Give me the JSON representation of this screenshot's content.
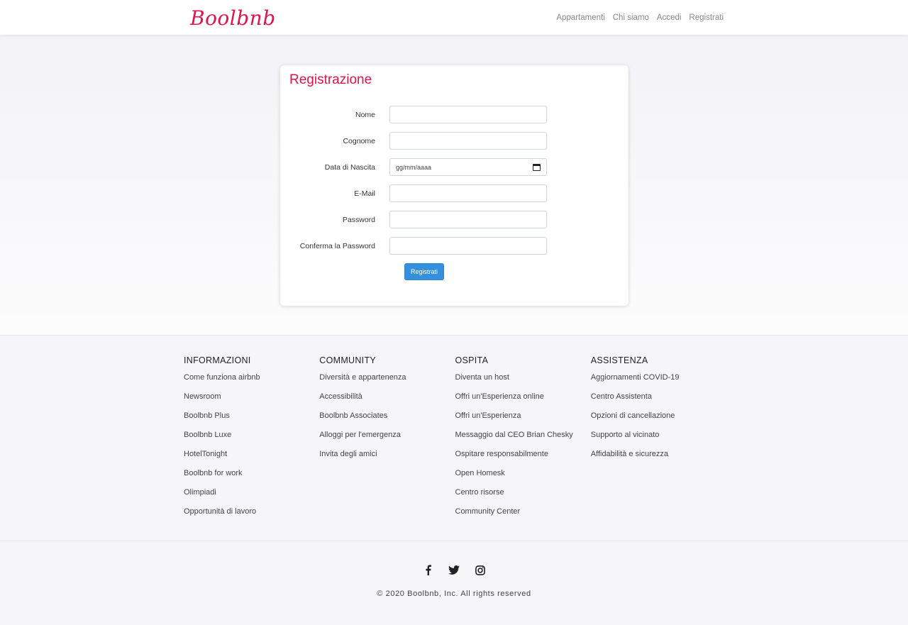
{
  "nav": {
    "brand": "Boolbnb",
    "links": [
      "Appartamenti",
      "Chi siamo",
      "Accedi",
      "Registrati"
    ]
  },
  "form": {
    "title": "Registrazione",
    "fields": [
      {
        "label": "Nome",
        "value": ""
      },
      {
        "label": "Cognome",
        "value": ""
      },
      {
        "label": "Data di Nascita",
        "value": "gg/mm/aaaa"
      },
      {
        "label": "E-Mail",
        "value": ""
      },
      {
        "label": "Password",
        "value": ""
      },
      {
        "label": "Conferma la Password",
        "value": ""
      }
    ],
    "submit_label": "Registrati",
    "accent_color": "#e0144c",
    "button_color": "#3490dc"
  },
  "footer": {
    "columns": [
      {
        "title": "INFORMAZIONI",
        "links": [
          "Come funziona airbnb",
          "Newsroom",
          "Boolbnb Plus",
          "Boolbnb Luxe",
          "HotelTonight",
          "Boolbnb for work",
          "Olimpiadi",
          "Opportunità di lavoro"
        ]
      },
      {
        "title": "COMMUNITY",
        "links": [
          "Diversità e appartenenza",
          "Accessibilità",
          "Boolbnb Associates",
          "Alloggi per l'emergenza",
          "Invita degli amici"
        ]
      },
      {
        "title": "OSPITA",
        "links": [
          "Diventa un host",
          "Offri un'Esperienza online",
          "Offri un'Esperienza",
          "Messaggio dal CEO Brian Chesky",
          "Ospitare responsabilmente",
          "Open Homesk",
          "Centro risorse",
          "Community Center"
        ]
      },
      {
        "title": "ASSISTENZA",
        "links": [
          "Aggiornamenti COVID-19",
          "Centro Assistenta",
          "Opzioni di cancellazione",
          "Supporto al vicinato",
          "Affidabilità e sicurezza"
        ]
      }
    ],
    "socials": [
      "facebook-icon",
      "twitter-icon",
      "instagram-icon"
    ],
    "copyright": "© 2020 Boolbnb, Inc. All rights reserved"
  }
}
